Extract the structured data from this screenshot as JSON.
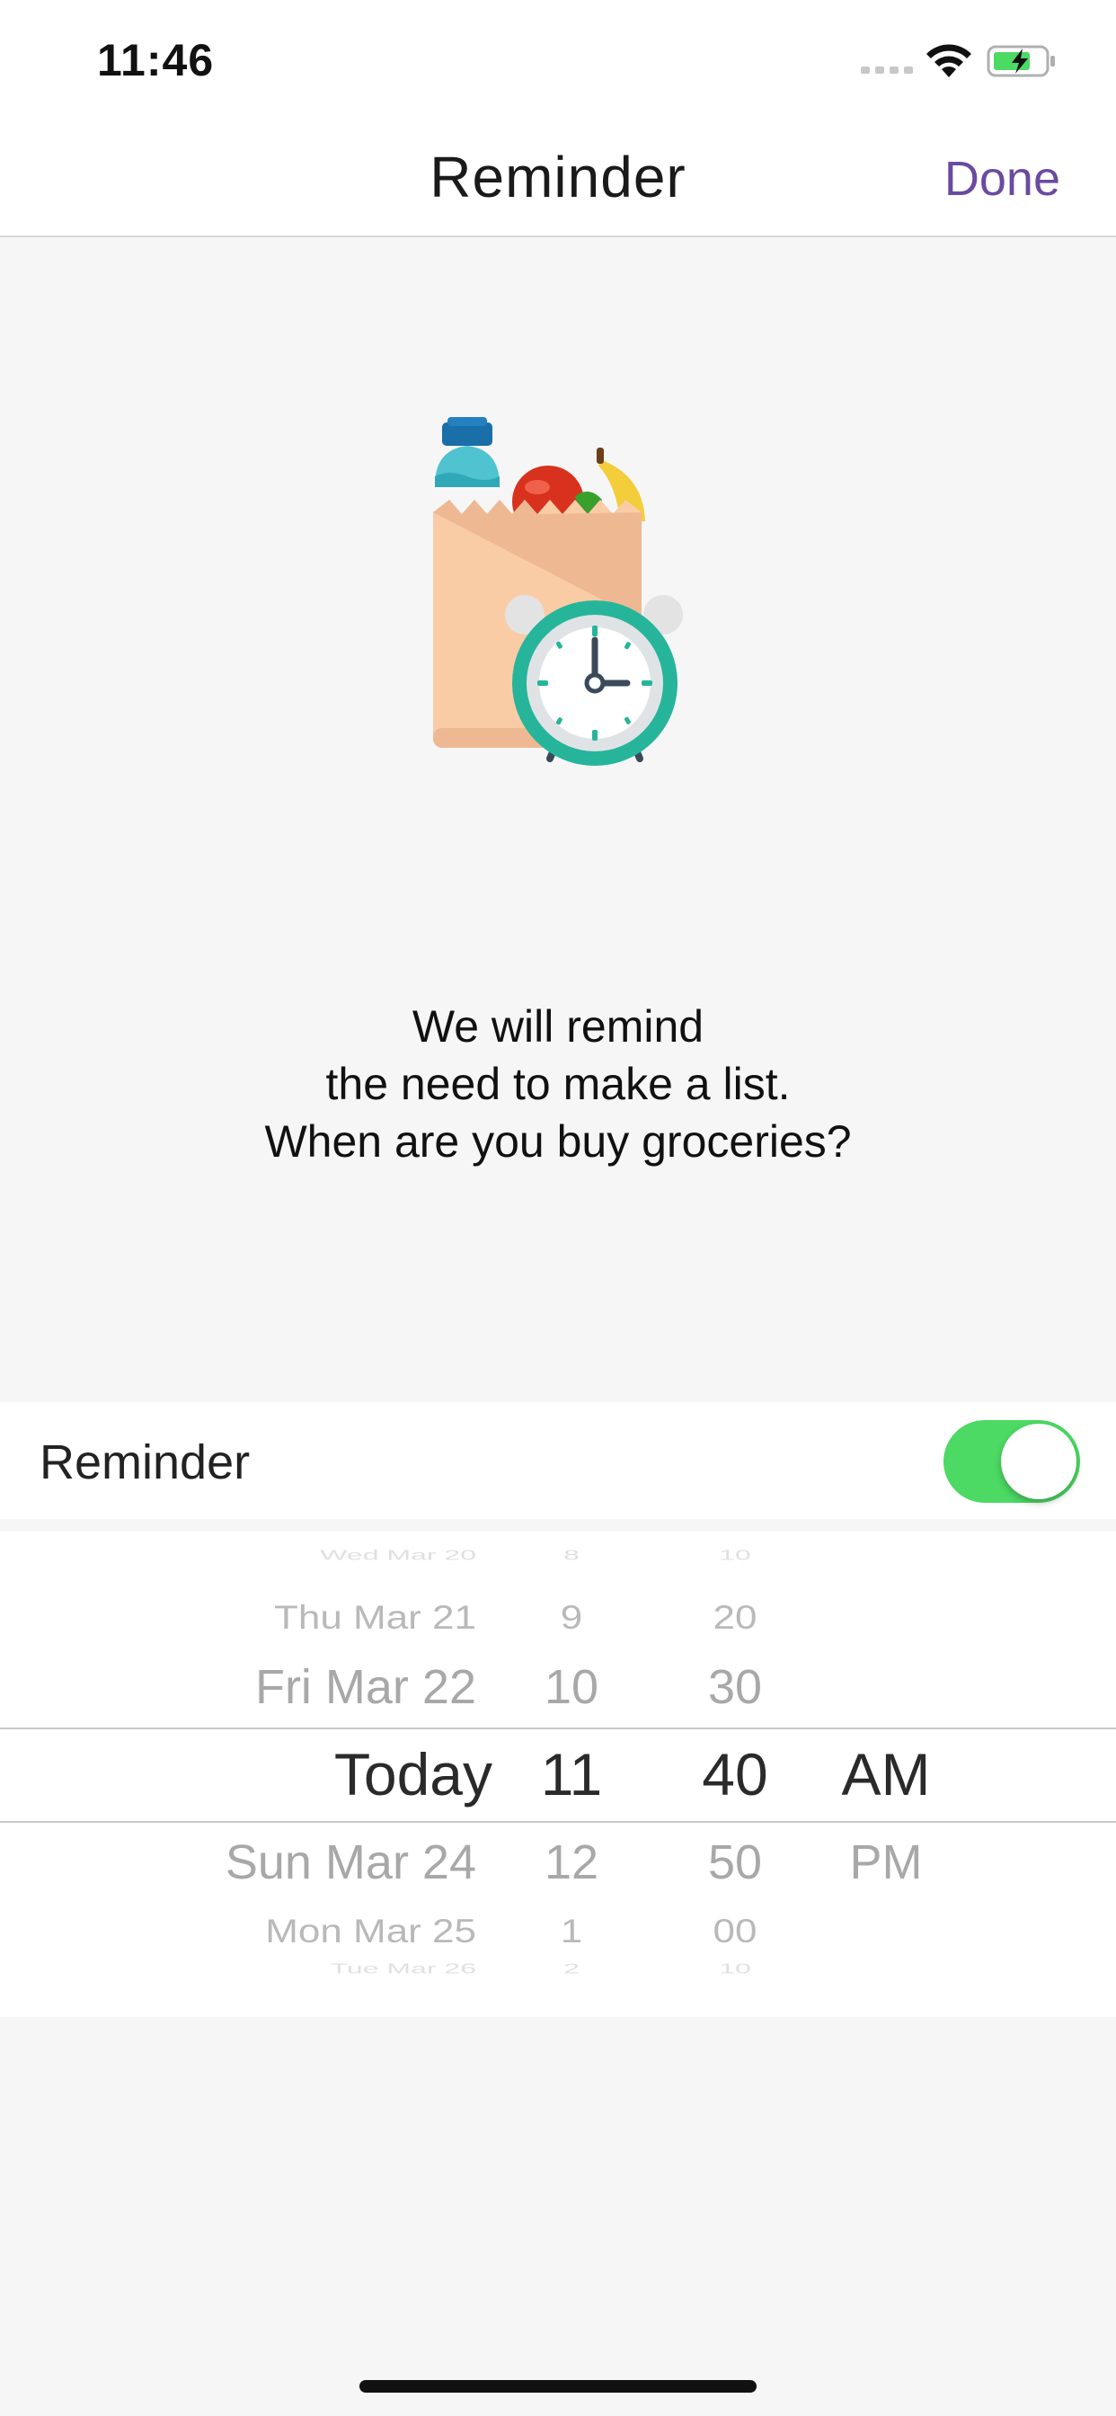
{
  "status_bar": {
    "time": "11:46"
  },
  "nav": {
    "title": "Reminder",
    "done_label": "Done"
  },
  "message": {
    "line1": "We will remind",
    "line2": "the need to make a list.",
    "line3": "When are you buy groceries?"
  },
  "reminder": {
    "label": "Reminder",
    "enabled": true
  },
  "picker": {
    "dates": [
      "Wed Mar 20",
      "Thu Mar 21",
      "Fri Mar 22",
      "Today",
      "Sun Mar 24",
      "Mon Mar 25",
      "Tue Mar 26"
    ],
    "hours": [
      "8",
      "9",
      "10",
      "11",
      "12",
      "1",
      "2"
    ],
    "minutes": [
      "10",
      "20",
      "30",
      "40",
      "50",
      "00",
      "10"
    ],
    "periods": [
      "AM",
      "PM"
    ],
    "selected": {
      "date": "Today",
      "hour": "11",
      "minute": "40",
      "period": "AM"
    }
  },
  "colors": {
    "accent": "#6a4ba0",
    "toggle_on": "#4cd964",
    "clock_ring": "#26b59a",
    "bag": "#f9cca6"
  }
}
